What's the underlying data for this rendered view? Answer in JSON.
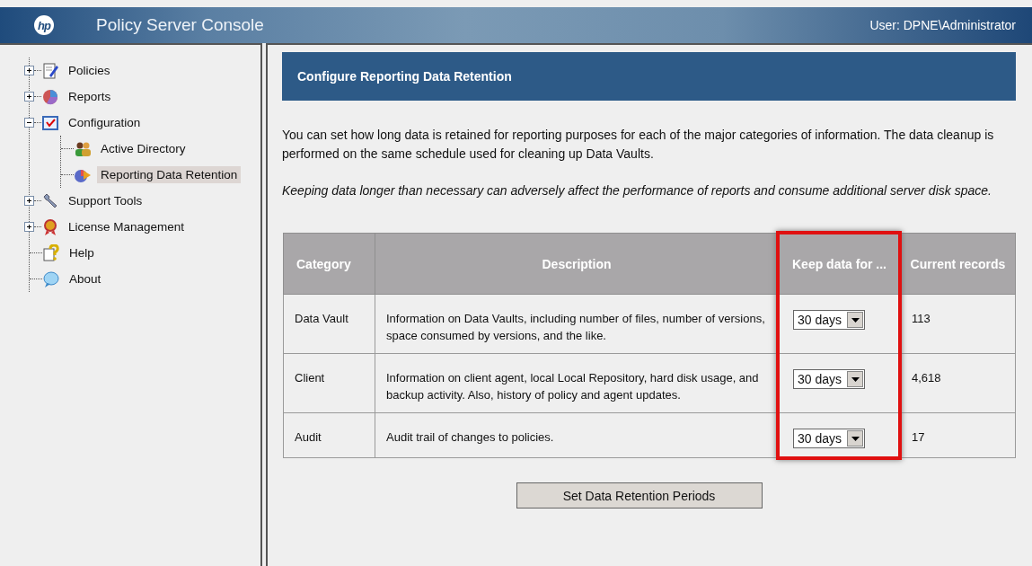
{
  "header": {
    "logo": "hp",
    "title": "Policy Server Console",
    "user": "User: DPNE\\Administrator"
  },
  "sidebar": {
    "items": [
      {
        "label": "Policies",
        "kind": "group",
        "expanded": false,
        "selected": false
      },
      {
        "label": "Reports",
        "kind": "group",
        "expanded": false,
        "selected": false
      },
      {
        "label": "Configuration",
        "kind": "group",
        "expanded": true,
        "selected": false,
        "children": [
          {
            "label": "Active Directory",
            "selected": false
          },
          {
            "label": "Reporting Data Retention",
            "selected": true
          }
        ]
      },
      {
        "label": "Support Tools",
        "kind": "group",
        "expanded": false,
        "selected": false
      },
      {
        "label": "License Management",
        "kind": "group",
        "expanded": false,
        "selected": false
      },
      {
        "label": "Help",
        "kind": "page",
        "selected": false
      },
      {
        "label": "About",
        "kind": "page",
        "selected": false
      }
    ]
  },
  "panel": {
    "title": "Configure Reporting Data Retention",
    "intro": "You can set how long data is retained for reporting purposes for each of the major categories of information. The data cleanup is performed on the same schedule used for cleaning up Data Vaults.",
    "note": "Keeping data longer than necessary can adversely affect the performance of reports and consume additional server disk space.",
    "table": {
      "columns": [
        {
          "label": "Category",
          "highlighted": false
        },
        {
          "label": "Description",
          "highlighted": false
        },
        {
          "label": "Keep data for ...",
          "highlighted": true
        },
        {
          "label": "Current records",
          "highlighted": false
        }
      ],
      "rows": [
        {
          "category": "Data Vault",
          "description": "Information on Data Vaults, including number of files, number of versions, space consumed by versions, and the like.",
          "keep": "30 days",
          "records": "113"
        },
        {
          "category": "Client",
          "description": "Information on client agent, local Local Repository, hard disk usage, and backup activity. Also, history of policy and agent updates.",
          "keep": "30 days",
          "records": "4,618"
        },
        {
          "category": "Audit",
          "description": "Audit trail of changes to policies.",
          "keep": "30 days",
          "records": "17"
        }
      ]
    },
    "button": "Set Data Retention Periods"
  }
}
